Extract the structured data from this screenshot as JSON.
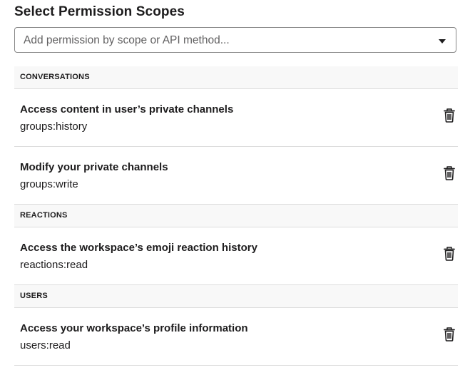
{
  "header": {
    "title": "Select Permission Scopes"
  },
  "scope_select": {
    "placeholder": "Add permission by scope or API method...",
    "caret_icon": "caret-down-icon"
  },
  "groups": [
    {
      "label": "CONVERSATIONS",
      "scopes": [
        {
          "title": "Access content in user’s private channels",
          "key": "groups:history",
          "delete_icon": "trash-icon"
        },
        {
          "title": "Modify your private channels",
          "key": "groups:write",
          "delete_icon": "trash-icon"
        }
      ]
    },
    {
      "label": "REACTIONS",
      "scopes": [
        {
          "title": "Access the workspace’s emoji reaction history",
          "key": "reactions:read",
          "delete_icon": "trash-icon"
        }
      ]
    },
    {
      "label": "USERS",
      "scopes": [
        {
          "title": "Access your workspace’s profile information",
          "key": "users:read",
          "delete_icon": "trash-icon"
        }
      ]
    }
  ]
}
